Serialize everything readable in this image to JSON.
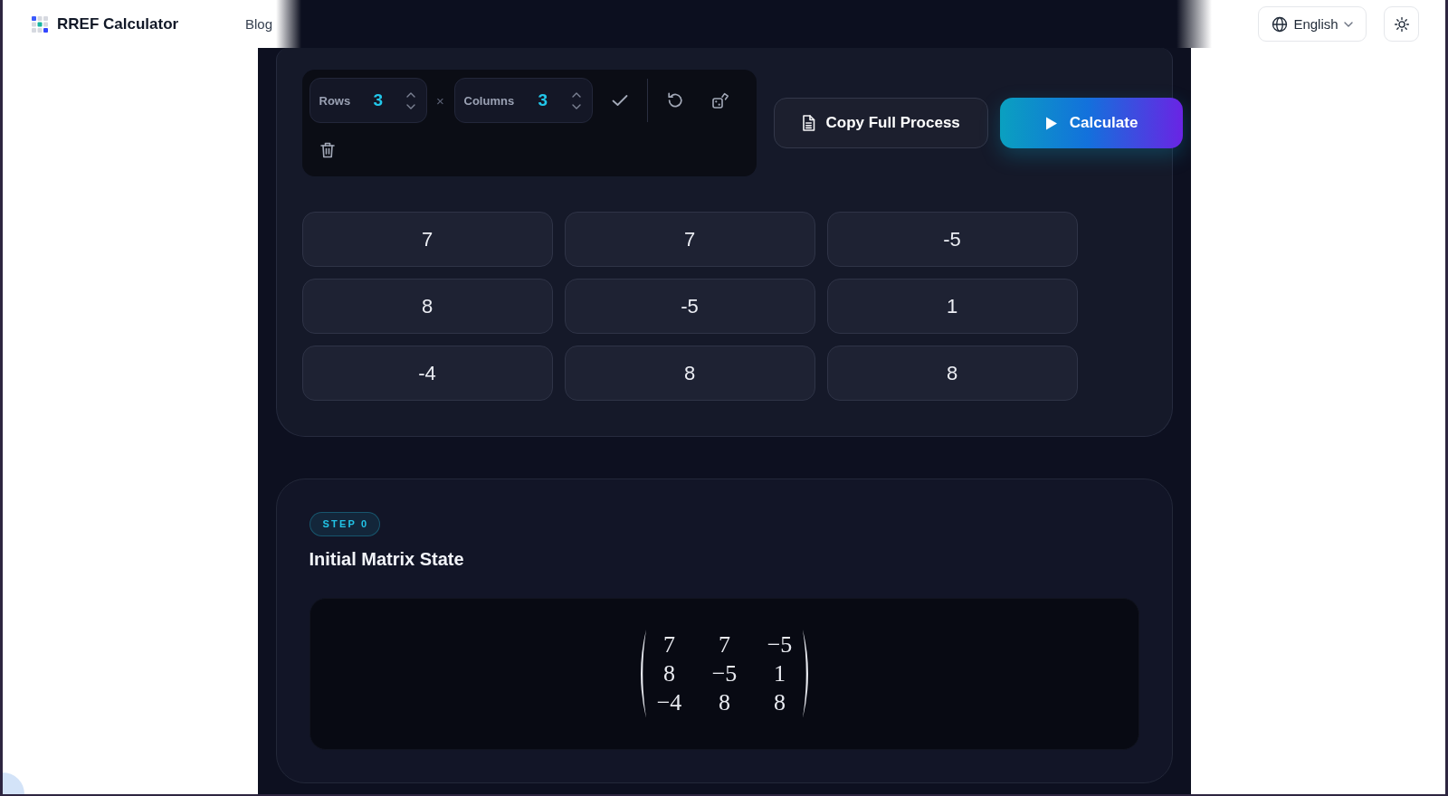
{
  "header": {
    "brand": "RREF Calculator",
    "nav": [
      "Blog"
    ],
    "language": "English"
  },
  "toolbar": {
    "rows": {
      "label": "Rows",
      "value": "3"
    },
    "times_sign": "×",
    "columns": {
      "label": "Columns",
      "value": "3"
    }
  },
  "actions": [
    {
      "kind": "secondary",
      "label": "Copy Full Process"
    },
    {
      "kind": "primary",
      "label": "Calculate"
    }
  ],
  "matrix": [
    [
      "7",
      "7",
      "-5"
    ],
    [
      "8",
      "-5",
      "1"
    ],
    [
      "-4",
      "8",
      "8"
    ]
  ],
  "steps": [
    {
      "label": "STEP 0",
      "title": "Initial Matrix State",
      "matrix": [
        [
          "7",
          "7",
          "−5"
        ],
        [
          "8",
          "−5",
          "1"
        ],
        [
          "−4",
          "8",
          "8"
        ]
      ]
    }
  ]
}
